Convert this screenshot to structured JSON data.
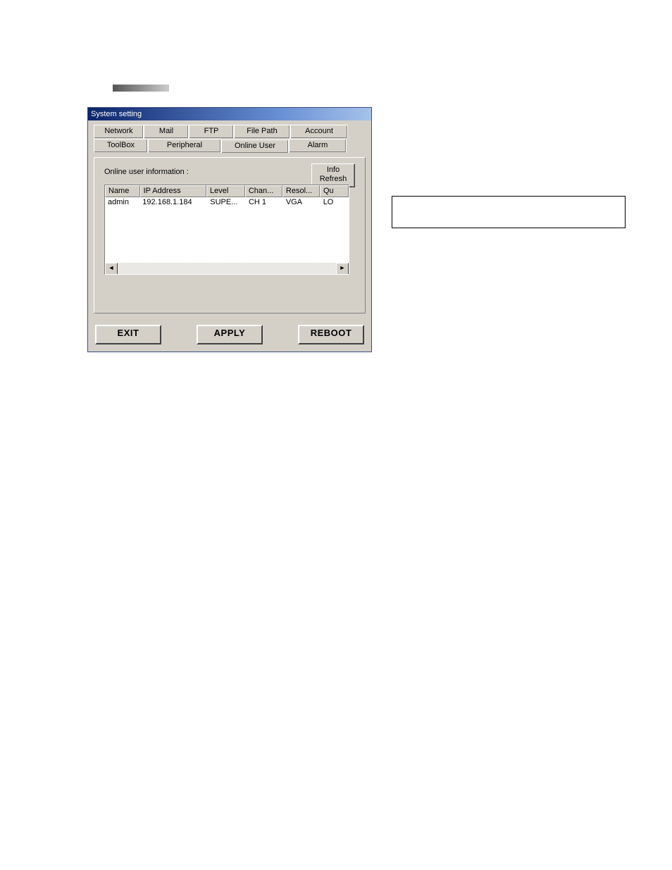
{
  "window": {
    "title": "System setting"
  },
  "tabs": {
    "row1": [
      "Network",
      "Mail",
      "FTP",
      "File Path",
      "Account"
    ],
    "row2": [
      "ToolBox",
      "Peripheral",
      "Online User",
      "Alarm"
    ],
    "active": "Online User"
  },
  "panel": {
    "info_label": "Online user information :",
    "refresh_line1": "Info",
    "refresh_line2": "Refresh"
  },
  "listview": {
    "columns": [
      "Name",
      "IP Address",
      "Level",
      "Chan...",
      "Resol...",
      "Qu"
    ],
    "rows": [
      {
        "name": "admin",
        "ip": "192.168.1.184",
        "level": "SUPE...",
        "chan": "CH 1",
        "resol": "VGA",
        "qual": "LO"
      }
    ]
  },
  "buttons": {
    "exit": "EXIT",
    "apply": "APPLY",
    "reboot": "REBOOT"
  },
  "scroll": {
    "left_arrow": "◄",
    "right_arrow": "►"
  }
}
